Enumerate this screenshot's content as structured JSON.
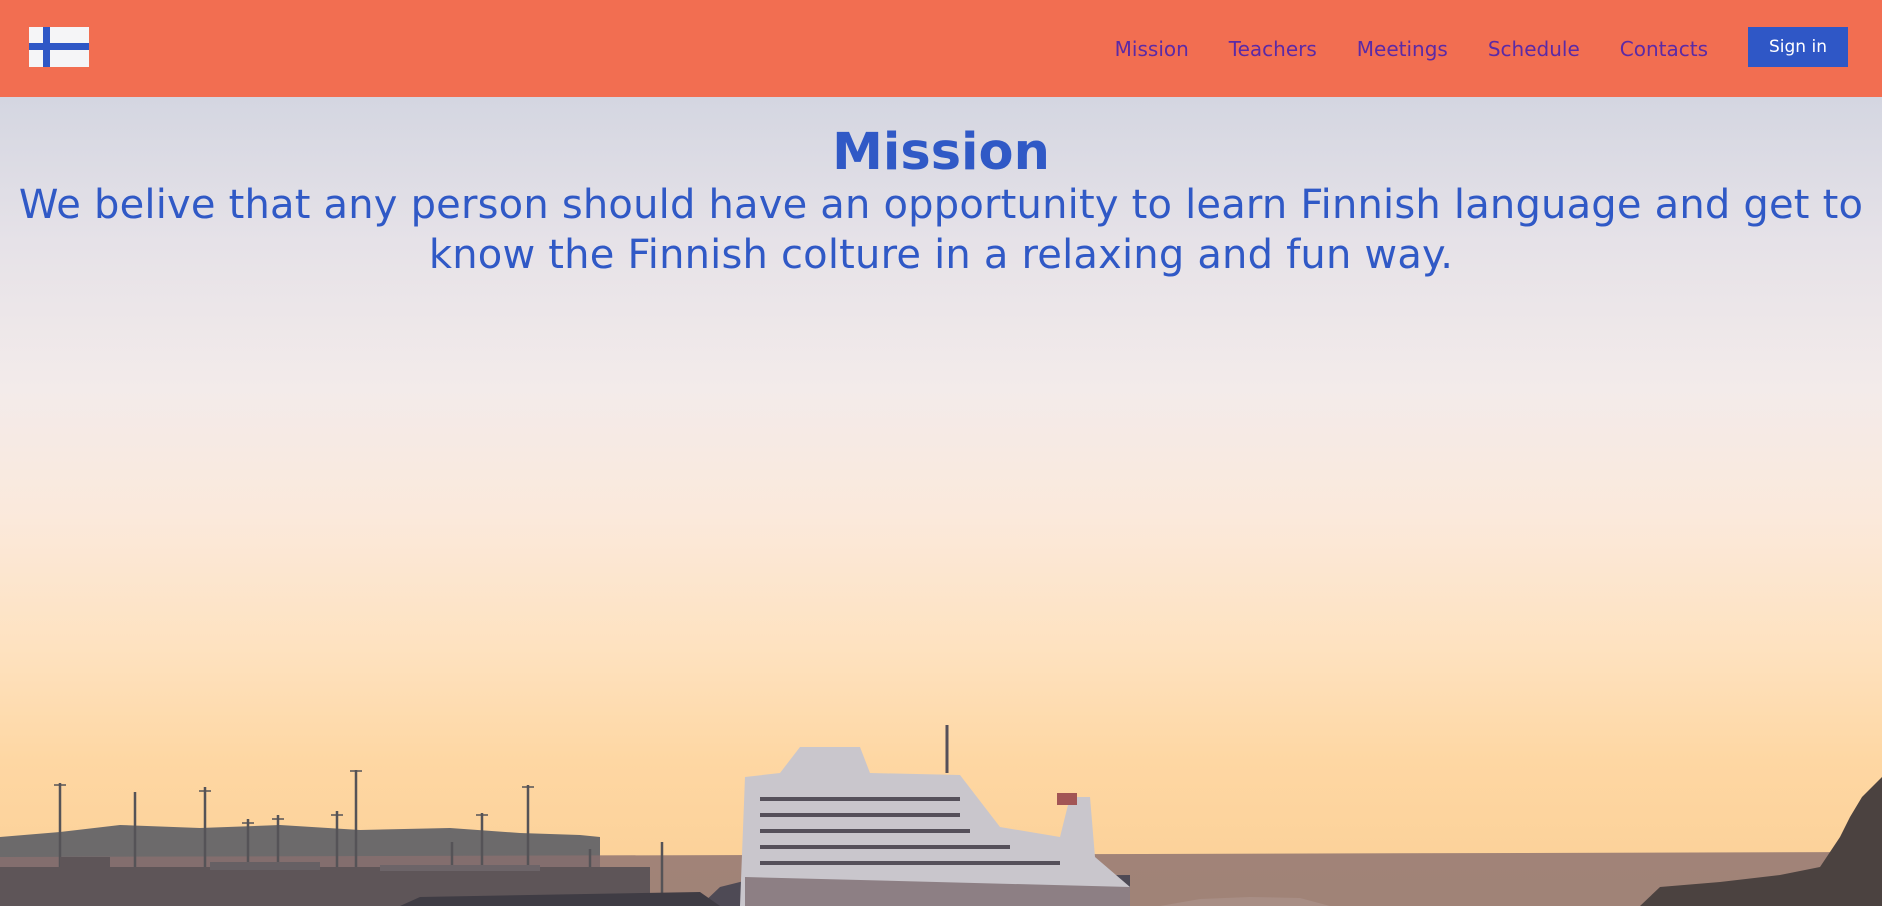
{
  "navbar": {
    "background": "#f26e51",
    "logo": {
      "icon": "finland-flag-icon"
    },
    "links": [
      "Mission",
      "Teachers",
      "Meetings",
      "Schedule",
      "Contacts"
    ],
    "link_color": "#5b2aa6",
    "signin_label": "Sign in",
    "signin_color": "#2f57c6"
  },
  "hero": {
    "title": "Mission",
    "text": "We belive that any person should have an opportunity to learn Finnish language and get to know the Finnish colture in a relaxing and fun way.",
    "text_color": "#3059c6",
    "background_image": "sunset harbor with ferry ship"
  }
}
